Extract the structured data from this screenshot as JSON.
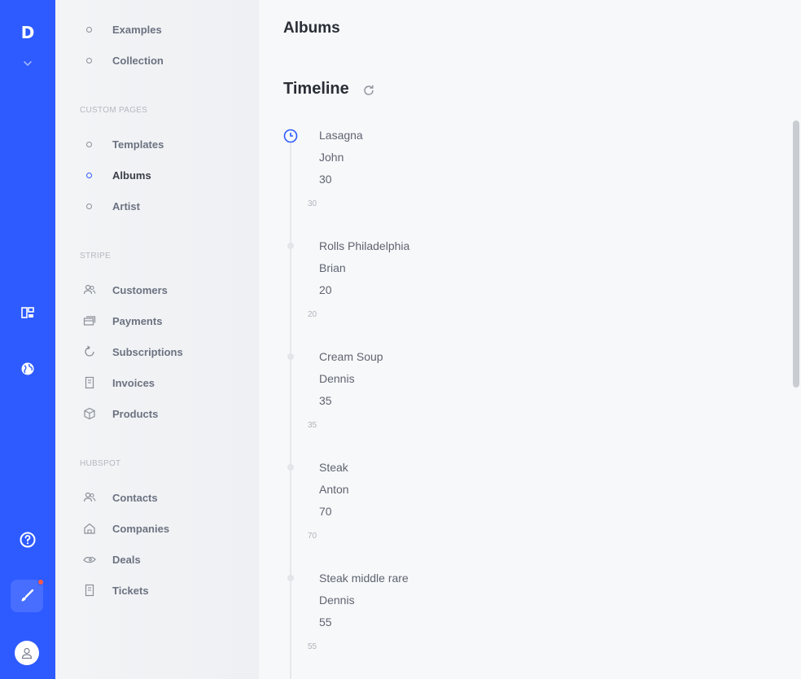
{
  "rail": {
    "logo": "D"
  },
  "sidebar": {
    "items_top": [
      {
        "label": "Examples"
      },
      {
        "label": "Collection"
      }
    ],
    "sections": [
      {
        "title": "CUSTOM PAGES",
        "items": [
          {
            "label": "Templates",
            "active": false
          },
          {
            "label": "Albums",
            "active": true
          },
          {
            "label": "Artist",
            "active": false
          }
        ]
      },
      {
        "title": "STRIPE",
        "items": [
          {
            "label": "Customers",
            "icon": "users-icon"
          },
          {
            "label": "Payments",
            "icon": "card-icon"
          },
          {
            "label": "Subscriptions",
            "icon": "refresh-icon"
          },
          {
            "label": "Invoices",
            "icon": "document-icon"
          },
          {
            "label": "Products",
            "icon": "box-icon"
          }
        ]
      },
      {
        "title": "HUBSPOT",
        "items": [
          {
            "label": "Contacts",
            "icon": "users-icon"
          },
          {
            "label": "Companies",
            "icon": "home-icon"
          },
          {
            "label": "Deals",
            "icon": "handshake-icon"
          },
          {
            "label": "Tickets",
            "icon": "document-icon"
          }
        ]
      }
    ]
  },
  "main": {
    "page_title": "Albums",
    "timeline_title": "Timeline",
    "entries": [
      {
        "name": "Lasagna",
        "person": "John",
        "value": "30",
        "foot": "30"
      },
      {
        "name": "Rolls Philadelphia",
        "person": "Brian",
        "value": "20",
        "foot": "20"
      },
      {
        "name": "Cream Soup",
        "person": "Dennis",
        "value": "35",
        "foot": "35"
      },
      {
        "name": "Steak",
        "person": "Anton",
        "value": "70",
        "foot": "70"
      },
      {
        "name": "Steak middle rare",
        "person": "Dennis",
        "value": "55",
        "foot": "55"
      }
    ]
  },
  "colors": {
    "accent": "#2e5bff",
    "notification": "#ff5a4a"
  }
}
